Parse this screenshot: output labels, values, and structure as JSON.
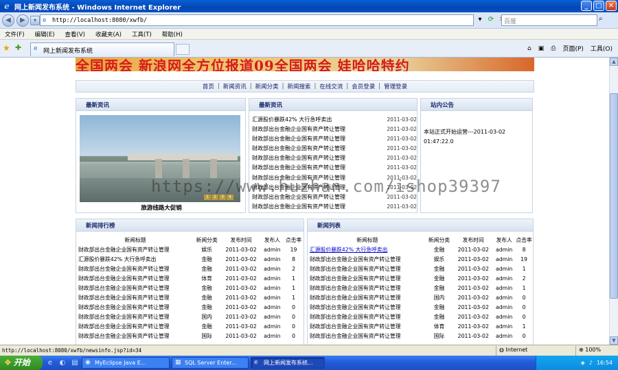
{
  "window": {
    "title": "网上新闻发布系统 - Windows Internet Explorer",
    "buttons": [
      "_",
      "□",
      "✕"
    ]
  },
  "address_bar": {
    "url": "http://localhost:8080/xwfb/",
    "search_placeholder": "百度"
  },
  "menu": [
    "文件(F)",
    "编辑(E)",
    "查看(V)",
    "收藏夹(A)",
    "工具(T)",
    "帮助(H)"
  ],
  "tab": {
    "title": "网上新闻发布系统",
    "tools": [
      "页面(P)",
      "工具(O)"
    ]
  },
  "banner": {
    "text": "全国两会 新浪网全方位报道09全国两会 娃哈哈特约"
  },
  "nav": {
    "links": [
      "首页",
      "新闻资讯",
      "新闻分类",
      "新闻搜索",
      "在线交流",
      "会员登录",
      "管理登录"
    ]
  },
  "panel_featured": {
    "title": "最新资讯",
    "caption": "旅游线路大促销",
    "pager": [
      "1",
      "2",
      "3",
      "4"
    ]
  },
  "panel_latest": {
    "title": "最新资讯",
    "items": [
      {
        "title": "汇源股价暴跌42% 大行急呼卖出",
        "date": "2011-03-02"
      },
      {
        "title": "财政部出台金融企业国有资产转让管理",
        "date": "2011-03-02"
      },
      {
        "title": "财政部出台金融企业国有资产转让管理",
        "date": "2011-03-02"
      },
      {
        "title": "财政部出台金融企业国有资产转让管理",
        "date": "2011-03-02"
      },
      {
        "title": "财政部出台金融企业国有资产转让管理",
        "date": "2011-03-02"
      },
      {
        "title": "财政部出台金融企业国有资产转让管理",
        "date": "2011-03-02"
      },
      {
        "title": "财政部出台金融企业国有资产转让管理",
        "date": "2011-03-02"
      },
      {
        "title": "财政部出台金融企业国有资产转让管理",
        "date": "2011-03-02"
      },
      {
        "title": "财政部出台金融企业国有资产转让管理",
        "date": "2011-03-02"
      },
      {
        "title": "财政部出台金融企业国有资产转让管理",
        "date": "2011-03-02"
      }
    ]
  },
  "panel_notice": {
    "title": "站内公告",
    "text": "本站正式开始运营---2011-03-02 01:47:22.0"
  },
  "panel_rank": {
    "title": "新闻排行榜",
    "headers": [
      "新闻标题",
      "新闻分类",
      "发布时间",
      "发布人",
      "点击率"
    ],
    "rows": [
      [
        "财政部出台金融企业国有资产转让管理",
        "娱乐",
        "2011-03-02",
        "admin",
        "19"
      ],
      [
        "汇源股价暴跌42% 大行急呼卖出",
        "金融",
        "2011-03-02",
        "admin",
        "8"
      ],
      [
        "财政部出台金融企业国有资产转让管理",
        "金融",
        "2011-03-02",
        "admin",
        "2"
      ],
      [
        "财政部出台金融企业国有资产转让管理",
        "体育",
        "2011-03-02",
        "admin",
        "1"
      ],
      [
        "财政部出台金融企业国有资产转让管理",
        "金融",
        "2011-03-02",
        "admin",
        "1"
      ],
      [
        "财政部出台金融企业国有资产转让管理",
        "金融",
        "2011-03-02",
        "admin",
        "1"
      ],
      [
        "财政部出台金融企业国有资产转让管理",
        "金融",
        "2011-03-02",
        "admin",
        "0"
      ],
      [
        "财政部出台金融企业国有资产转让管理",
        "国内",
        "2011-03-02",
        "admin",
        "0"
      ],
      [
        "财政部出台金融企业国有资产转让管理",
        "金融",
        "2011-03-02",
        "admin",
        "0"
      ],
      [
        "财政部出台金融企业国有资产转让管理",
        "国际",
        "2011-03-02",
        "admin",
        "0"
      ]
    ]
  },
  "panel_list": {
    "title": "新闻列表",
    "headers": [
      "新闻标题",
      "新闻分类",
      "发布时间",
      "发布人",
      "点击率"
    ],
    "rows": [
      [
        "汇源股价暴跌42% 大行急呼卖出",
        "金融",
        "2011-03-02",
        "admin",
        "8"
      ],
      [
        "财政部出台金融企业国有资产转让管理",
        "娱乐",
        "2011-03-02",
        "admin",
        "19"
      ],
      [
        "财政部出台金融企业国有资产转让管理",
        "金融",
        "2011-03-02",
        "admin",
        "1"
      ],
      [
        "财政部出台金融企业国有资产转让管理",
        "金融",
        "2011-03-02",
        "admin",
        "2"
      ],
      [
        "财政部出台金融企业国有资产转让管理",
        "金融",
        "2011-03-02",
        "admin",
        "1"
      ],
      [
        "财政部出台金融企业国有资产转让管理",
        "国内",
        "2011-03-02",
        "admin",
        "0"
      ],
      [
        "财政部出台金融企业国有资产转让管理",
        "金融",
        "2011-03-02",
        "admin",
        "0"
      ],
      [
        "财政部出台金融企业国有资产转让管理",
        "金融",
        "2011-03-02",
        "admin",
        "0"
      ],
      [
        "财政部出台金融企业国有资产转让管理",
        "体育",
        "2011-03-02",
        "admin",
        "1"
      ],
      [
        "财政部出台金融企业国有资产转让管理",
        "国际",
        "2011-03-02",
        "admin",
        "0"
      ]
    ]
  },
  "watermark": "https://www.huzhan.com/ishop39397",
  "status": {
    "link": "http://localhost:8080/xwfb/newsinfo.jsp?id=34",
    "zone": "Internet",
    "zoom": "100%"
  },
  "taskbar": {
    "start": "开始",
    "tasks": [
      "MyEclipse Java E...",
      "SQL Server Enter...",
      "网上新闻发布系统..."
    ],
    "clock": "16:54"
  }
}
